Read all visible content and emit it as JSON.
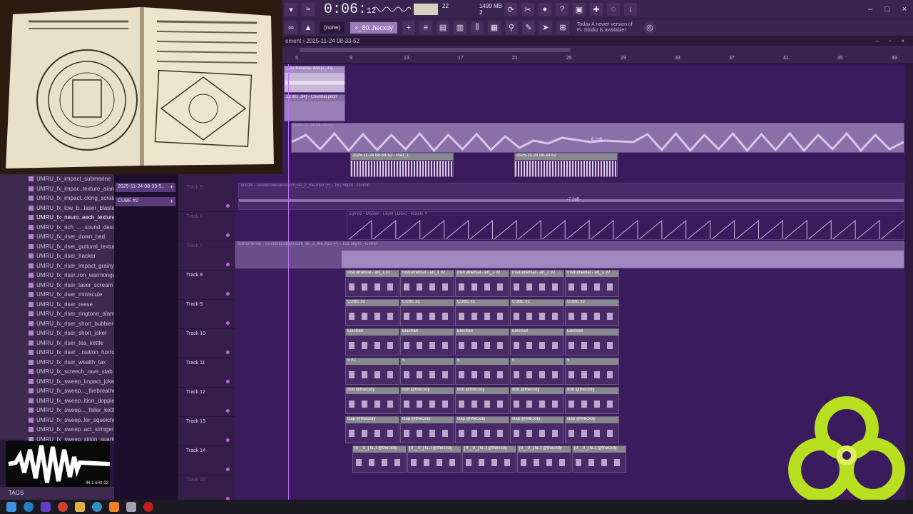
{
  "toolbar": {
    "time_main": "0:06:",
    "time_sub": "12",
    "cpu_value": "22",
    "ram_value": "1499 MB",
    "voices": "2",
    "preset": "(none)",
    "pattern": "×_80..hecxdy",
    "news_line1": "Today  A newer version of",
    "news_line2": "FL Studio is available!"
  },
  "playlist": {
    "title": "ement › 2025-11-24 08-33-52",
    "ruler_ticks": [
      "5",
      "9",
      "13",
      "17",
      "21",
      "25",
      "29",
      "33",
      "37",
      "41",
      "45",
      "49"
    ]
  },
  "browser": {
    "items": [
      "UMRU_fx_impact_submarine",
      "UMRU_fx_impac..texture_alarm",
      "UMRU_fx_impact..cking_scratch",
      "UMRU_fx_low_b...laser_blaster",
      "UMRU_fx_neuro..eech_texture",
      "UMRU_fx_rich_..._sound_design",
      "UMRU_fx_riser_down_bad",
      "UMRU_fx_riser_guttural_texture",
      "UMRU_fx_riser_hacker",
      "UMRU_fx_riser_impact_grainy",
      "UMRU_fx_riser..ion_warmonger",
      "UMRU_fx_riser_laser_scream",
      "UMRU_fx_riser_miniscule",
      "UMRU_fx_riser_reese",
      "UMRU_fx_riser_ringtone_alarm",
      "UMRU_fx_riser_short_bubbler",
      "UMRU_fx_riser_short_joker",
      "UMRU_fx_riser_tea_kettle",
      "UMRU_fx_riser_..nsition_horror",
      "UMRU_fx_riser_wealth_tax",
      "UMRU_fx_screech_rave_stab",
      "UMRU_fx_sweep_impact_joker",
      "UMRU_fx_sweep..._firebreather",
      "UMRU_fx_sweep..ition_doppler",
      "UMRU_fx_sweep..._faller_kettle",
      "UMRU_fx_sweep..ler_squeicher",
      "UMRU_fx_sweep..act_stringent",
      "UMRU_fx_sweep..sition_sparks"
    ],
    "selected_index": 4,
    "preview_info": "44.1 kHz 32",
    "tags_label": "TAGS"
  },
  "picker": {
    "items": [
      "2025-11-24 08-33-5..",
      "CUBE #2"
    ]
  },
  "tracks": [
    {
      "label": "Track 5",
      "dim": true
    },
    {
      "label": "Track 6",
      "dim": true
    },
    {
      "label": "Track 7",
      "dim": true
    },
    {
      "label": "Track 8",
      "dim": false
    },
    {
      "label": "Track 9",
      "dim": false
    },
    {
      "label": "Track 10",
      "dim": false
    },
    {
      "label": "Track 11",
      "dim": false
    },
    {
      "label": "Track 12",
      "dim": false
    },
    {
      "label": "Track 13",
      "dim": false
    },
    {
      "label": "Track 14",
      "dim": false
    },
    {
      "label": "Track 15",
      "dim": true
    }
  ],
  "clips": {
    "reverse_will": "...he Reverse Will [1_33]",
    "channel_pitch": "21 ll[0...34] - Channel pitch",
    "long_audio": "2025-11-24 08-33-52",
    "part1": "2025-11-24 08-33-52 - Part_1",
    "part2": "2025-11-24 08-33-52",
    "vocals": "Vocals - soundcloudaud.com_lie_2_me.mp3 [+] - 151.5bpm - G#min",
    "vocals_db": "-7.2dB",
    "wave_db": "6.1dB",
    "zgeviz": "ZgeViz - Master - Layer LOGO - Rotate Y",
    "instrumental": "Instrumental - soundcloudaud.com_lie_2_me.mp3 [+] - 151.5bpm - G#min",
    "inst_art": "Instrumental - art_1 #2",
    "cube": "CUBE #2",
    "electrax": "ElectraX",
    "s2": "5 #2",
    "s": "5",
    "b808": "808 @thecxdy",
    "clap": "clap @thecxdy",
    "hi": "[0__0_] hi..t @thecxdy"
  },
  "colors": {
    "accent": "#c070ff",
    "playlist_bg": "#3a1c5e",
    "clip": "#9a80b8",
    "logo_green": "#b8e020"
  }
}
